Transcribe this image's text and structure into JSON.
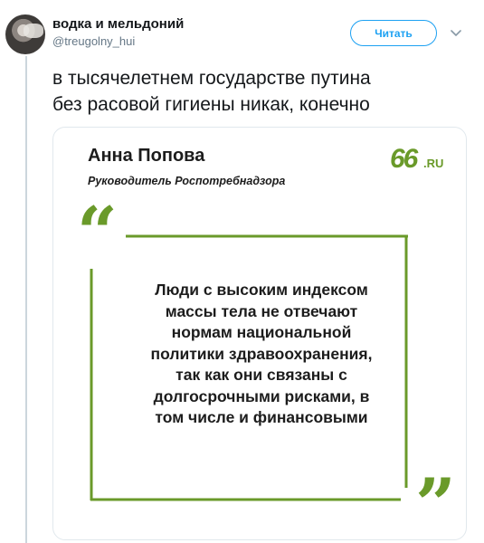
{
  "tweet": {
    "display_name": "водка и мельдоний",
    "handle": "@treugolny_hui",
    "follow_label": "Читать",
    "text_lines": [
      "в тысячелетнем государстве путина",
      "без расовой гигиены никак, конечно"
    ]
  },
  "card": {
    "person_name": "Анна Попова",
    "person_role": "Руководитель Роспотребнадзора",
    "logo_number": "66",
    "logo_suffix": ".RU",
    "quote_lines": [
      "Люди с высоким индексом",
      "массы тела не отвечают",
      "нормам национальной",
      "политики здравоохранения,",
      "так как они связаны с",
      "долгосрочными рисками, в",
      "том числе и финансовыми"
    ]
  },
  "colors": {
    "accent_green": "#6a9a2a",
    "twitter_blue": "#1da1f2",
    "text_dark": "#14171a",
    "text_muted": "#657786"
  },
  "icons": {
    "avatar": "user-avatar",
    "chevron": "chevron-down-icon",
    "quote_open": "open-quote-icon",
    "quote_close": "close-quote-icon"
  }
}
